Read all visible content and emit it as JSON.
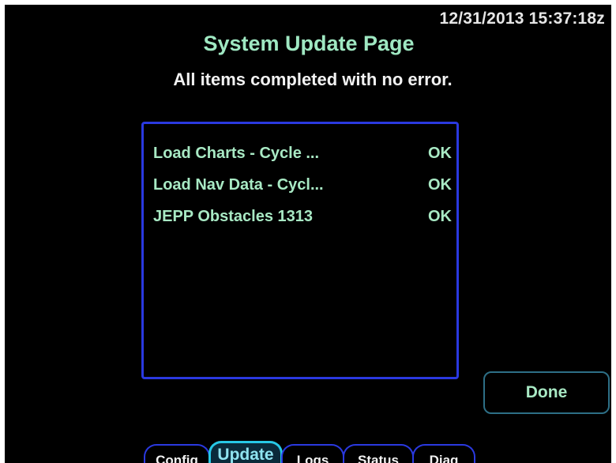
{
  "header": {
    "timestamp": "12/31/2013 15:37:18z",
    "title": "System Update Page",
    "status_message": "All items completed with no error."
  },
  "results": [
    {
      "name": "Load Charts - Cycle ...",
      "status": "OK"
    },
    {
      "name": "Load Nav Data - Cycl...",
      "status": "OK"
    },
    {
      "name": "JEPP Obstacles 1313",
      "status": "OK"
    }
  ],
  "actions": {
    "done_label": "Done"
  },
  "tabs": [
    {
      "label": "Config",
      "active": false
    },
    {
      "label": "Update",
      "active": true
    },
    {
      "label": "Logs",
      "active": false
    },
    {
      "label": "Status",
      "active": false
    },
    {
      "label": "Diag",
      "active": false
    }
  ],
  "colors": {
    "background": "#000000",
    "title_text": "#9fe8c2",
    "item_text": "#a8e9c4",
    "panel_border": "#2a39e0",
    "active_tab_border": "#27c8e6"
  }
}
